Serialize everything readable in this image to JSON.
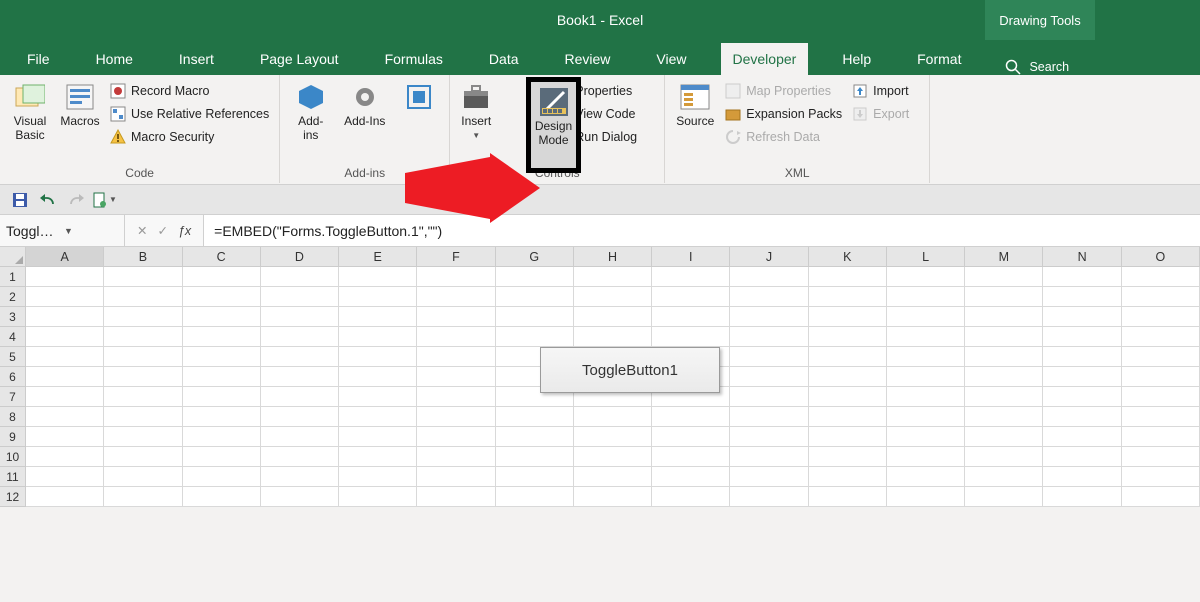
{
  "titlebar": {
    "title": "Book1  -  Excel",
    "tool_tab": "Drawing Tools"
  },
  "tabs": {
    "file": "File",
    "home": "Home",
    "insert": "Insert",
    "pagelayout": "Page Layout",
    "formulas": "Formulas",
    "data": "Data",
    "review": "Review",
    "view": "View",
    "developer": "Developer",
    "help": "Help",
    "format": "Format",
    "search": "Search"
  },
  "ribbon": {
    "code": {
      "visual_basic": "Visual\nBasic",
      "macros": "Macros",
      "record_macro": "Record Macro",
      "use_relative": "Use Relative References",
      "macro_security": "Macro Security",
      "label": "Code"
    },
    "addins": {
      "addins_big1": "Add-\nins",
      "addins_big2": "Add-Ins",
      "label": "Add-ins"
    },
    "controls": {
      "insert": "Insert",
      "design_mode": "Design\nMode",
      "properties": "Properties",
      "view_code": "View Code",
      "run_dialog": "Run Dialog",
      "label": "Controls"
    },
    "xml": {
      "source": "Source",
      "map_properties": "Map Properties",
      "expansion_packs": "Expansion Packs",
      "refresh_data": "Refresh Data",
      "import": "Import",
      "export": "Export",
      "label": "XML"
    }
  },
  "namebox": "ToggleBut...",
  "formula": "=EMBED(\"Forms.ToggleButton.1\",\"\")",
  "columns": [
    "A",
    "B",
    "C",
    "D",
    "E",
    "F",
    "G",
    "H",
    "I",
    "J",
    "K",
    "L",
    "M",
    "N",
    "O"
  ],
  "rows": [
    "1",
    "2",
    "3",
    "4",
    "5",
    "6",
    "7",
    "8",
    "9",
    "10",
    "11",
    "12"
  ],
  "toggle_label": "ToggleButton1"
}
